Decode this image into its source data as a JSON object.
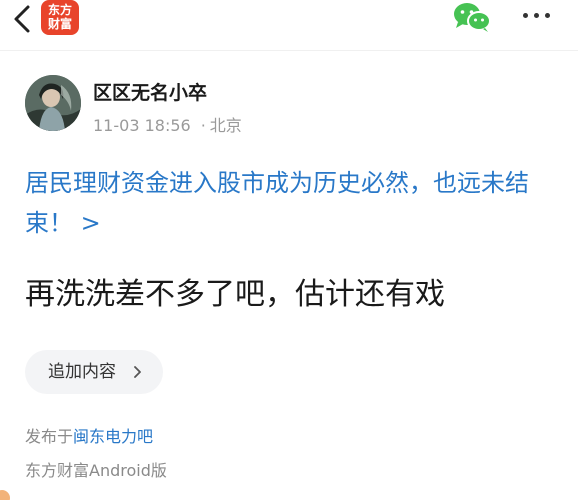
{
  "header": {
    "logo_line1": "东方",
    "logo_line2": "财富",
    "logo_color": "#e8442b",
    "icons": [
      "back-arrow-icon",
      "wechat-icon",
      "more-dots-icon"
    ]
  },
  "author": {
    "name": "区区无名小卒",
    "date": "11-03 18:56",
    "dot": "·",
    "location": "北京"
  },
  "post": {
    "title": "居民理财资金进入股市成为历史必然，也远未结束！ >",
    "body": "再洗洗差不多了吧，估计还有戏",
    "link_color": "#2978c8"
  },
  "actions": {
    "add_content": "追加内容"
  },
  "footer": {
    "published_prefix": "发布于",
    "forum": "闽东电力吧",
    "client": "东方财富Android版"
  }
}
